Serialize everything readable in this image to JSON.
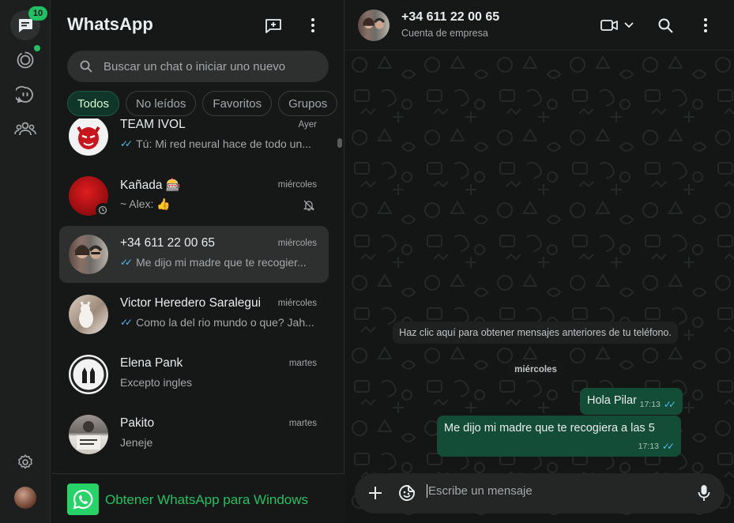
{
  "rail": {
    "chats_badge": "10",
    "icons": [
      "chats-icon",
      "status-icon",
      "channels-icon",
      "communities-icon",
      "settings-icon"
    ]
  },
  "sidebar": {
    "title": "WhatsApp",
    "search_placeholder": "Buscar un chat o iniciar uno nuevo",
    "filters": [
      {
        "label": "Todos",
        "active": true
      },
      {
        "label": "No leídos",
        "active": false
      },
      {
        "label": "Favoritos",
        "active": false
      },
      {
        "label": "Grupos",
        "active": false
      }
    ],
    "chats": [
      {
        "name": "TEAM IVOL",
        "time": "Ayer",
        "message": "Tú: Mi red neural hace de todo un...",
        "ticks": true
      },
      {
        "name": "Kañada 🎰",
        "time": "miércoles",
        "message": "~ Alex: 👍",
        "ticks": false,
        "muted": true
      },
      {
        "name": "+34 611 22 00 65",
        "time": "miércoles",
        "message": "Me dijo mi madre que te recogier...",
        "ticks": true,
        "selected": true
      },
      {
        "name": "Victor Heredero Saralegui",
        "time": "miércoles",
        "message": "Como la del rio mundo o que? Jah...",
        "ticks": true
      },
      {
        "name": "Elena Pank",
        "time": "martes",
        "message": "Excepto ingles",
        "ticks": false
      },
      {
        "name": "Pakito",
        "time": "martes",
        "message": "Jeneje",
        "ticks": false
      }
    ],
    "get_windows": "Obtener WhatsApp para Windows"
  },
  "conversation": {
    "contact_name": "+34 611 22 00 65",
    "contact_subtitle": "Cuenta de empresa",
    "system_notice": "Haz clic aquí para obtener mensajes anteriores de tu teléfono.",
    "date_separator": "miércoles",
    "messages": [
      {
        "text": "Hola Pilar",
        "time": "17:13"
      },
      {
        "text": "Me dijo mi madre que te recogiera a las 5",
        "time": "17:13"
      }
    ],
    "composer_placeholder": "Escribe un mensaje"
  },
  "colors": {
    "accent": "#21c063",
    "outgoing_bubble": "#144d37",
    "read_ticks": "#53bdeb",
    "background": "#161717"
  }
}
